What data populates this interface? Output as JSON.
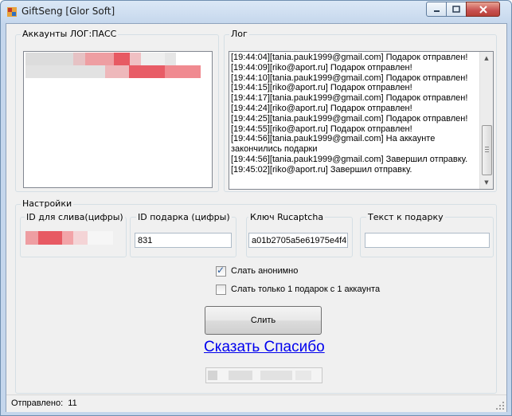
{
  "window": {
    "title": "GiftSeng  [Glor Soft]"
  },
  "accounts": {
    "title": "Аккаунты ЛОГ:ПАСС"
  },
  "log": {
    "title": "Лог",
    "lines": [
      "[19:44:04][tania.pauk1999@gmail.com] Подарок отправлен!",
      "[19:44:09][riko@aport.ru] Подарок отправлен!",
      "[19:44:10][tania.pauk1999@gmail.com] Подарок отправлен!",
      "[19:44:15][riko@aport.ru] Подарок отправлен!",
      "[19:44:17][tania.pauk1999@gmail.com] Подарок отправлен!",
      "[19:44:24][riko@aport.ru] Подарок отправлен!",
      "[19:44:25][tania.pauk1999@gmail.com] Подарок отправлен!",
      "[19:44:55][riko@aport.ru] Подарок отправлен!",
      "[19:44:56][tania.pauk1999@gmail.com] На аккаунте",
      "закончились подарки",
      "[19:44:56][tania.pauk1999@gmail.com] Завершил отправку.",
      "[19:45:02][riko@aport.ru] Завершил отправку."
    ]
  },
  "settings": {
    "title": "Настройки",
    "id_drain": {
      "label": "ID для слива(цифры)"
    },
    "gift_id": {
      "label": "ID подарка (цифры)",
      "value": "831"
    },
    "rucaptcha": {
      "label": "Ключ Rucaptcha",
      "value": "a01b2705a5e61975e4f4"
    },
    "gift_text": {
      "label": "Текст к подарку",
      "value": ""
    },
    "anonymous": {
      "label": "Слать анонимно",
      "checked": true
    },
    "one_gift": {
      "label": "Слать только 1 подарок с 1 аккаунта",
      "checked": false
    },
    "send_button": "Слить",
    "thanks_link": "Сказать Спасибо"
  },
  "status": {
    "label": "Отправлено:",
    "count": "11"
  },
  "colors": {
    "link": "#0000ee",
    "check": "#2c5c9c"
  }
}
